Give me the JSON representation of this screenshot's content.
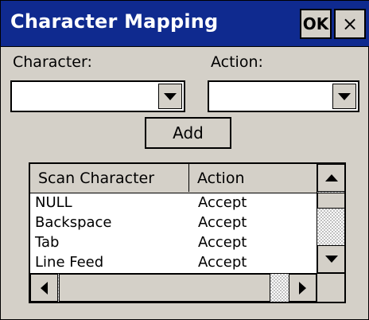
{
  "window": {
    "title": "Character Mapping",
    "ok_label": "OK",
    "close_label": "×"
  },
  "form": {
    "character_label": "Character:",
    "character_value": "",
    "action_label": "Action:",
    "action_value": "",
    "add_label": "Add"
  },
  "list": {
    "columns": [
      "Scan Character",
      "Action"
    ],
    "rows": [
      {
        "scan": "NULL",
        "action": "Accept"
      },
      {
        "scan": "Backspace",
        "action": "Accept"
      },
      {
        "scan": "Tab",
        "action": "Accept"
      },
      {
        "scan": "Line Feed",
        "action": "Accept"
      }
    ]
  },
  "colors": {
    "titlebar": "#0f2a8f",
    "face": "#d4d0c8"
  },
  "icons": {
    "dropdown": "chevron-down-icon",
    "scroll_up": "arrow-up-icon",
    "scroll_down": "arrow-down-icon",
    "scroll_left": "arrow-left-icon",
    "scroll_right": "arrow-right-icon"
  }
}
